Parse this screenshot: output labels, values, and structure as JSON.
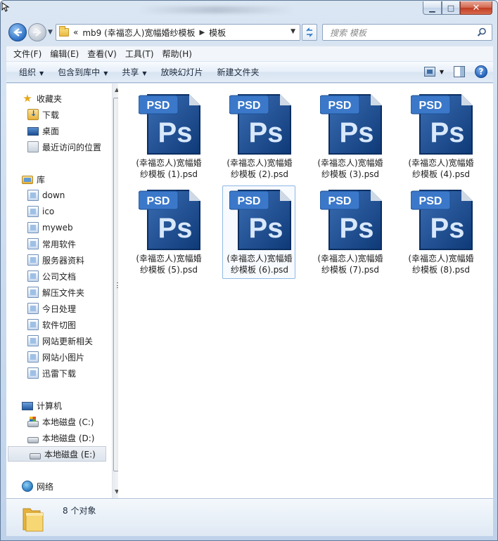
{
  "window": {
    "minimize_glyph": "▁",
    "maximize_glyph": "□",
    "close_glyph": "✕"
  },
  "address": {
    "overflow": "«",
    "path_parent": "mb9 (幸福恋人)宽幅婚纱模板",
    "separator": "▶",
    "path_current": "模板"
  },
  "search": {
    "placeholder": "搜索 模板"
  },
  "menu": [
    "文件(F)",
    "编辑(E)",
    "查看(V)",
    "工具(T)",
    "帮助(H)"
  ],
  "commands": [
    {
      "label": "组织",
      "dropdown": true
    },
    {
      "label": "包含到库中",
      "dropdown": true
    },
    {
      "label": "共享",
      "dropdown": true
    },
    {
      "label": "放映幻灯片",
      "dropdown": false
    },
    {
      "label": "新建文件夹",
      "dropdown": false
    }
  ],
  "help_label": "?",
  "nav": {
    "favorites": {
      "label": "收藏夹",
      "items": [
        "下载",
        "桌面",
        "最近访问的位置"
      ]
    },
    "libraries": {
      "label": "库",
      "items": [
        "down",
        "ico",
        "myweb",
        "常用软件",
        "服务器资料",
        "公司文档",
        "解压文件夹",
        "今日处理",
        "软件切图",
        "网站更新相关",
        "网站小图片",
        "迅雷下载"
      ]
    },
    "computer": {
      "label": "计算机",
      "items": [
        "本地磁盘 (C:)",
        "本地磁盘 (D:)",
        "本地磁盘 (E:)"
      ]
    },
    "network": {
      "label": "网络"
    }
  },
  "icon_text": {
    "psd": "PSD",
    "ps": "Ps"
  },
  "files": [
    {
      "line1": "(幸福恋人)宽幅婚",
      "line2": "纱模板 (1).psd"
    },
    {
      "line1": "(幸福恋人)宽幅婚",
      "line2": "纱模板 (2).psd"
    },
    {
      "line1": "(幸福恋人)宽幅婚",
      "line2": "纱模板 (3).psd"
    },
    {
      "line1": "(幸福恋人)宽幅婚",
      "line2": "纱模板 (4).psd"
    },
    {
      "line1": "(幸福恋人)宽幅婚",
      "line2": "纱模板 (5).psd"
    },
    {
      "line1": "(幸福恋人)宽幅婚",
      "line2": "纱模板 (6).psd"
    },
    {
      "line1": "(幸福恋人)宽幅婚",
      "line2": "纱模板 (7).psd"
    },
    {
      "line1": "(幸福恋人)宽幅婚",
      "line2": "纱模板 (8).psd"
    }
  ],
  "status": {
    "count_text": "8 个对象"
  }
}
